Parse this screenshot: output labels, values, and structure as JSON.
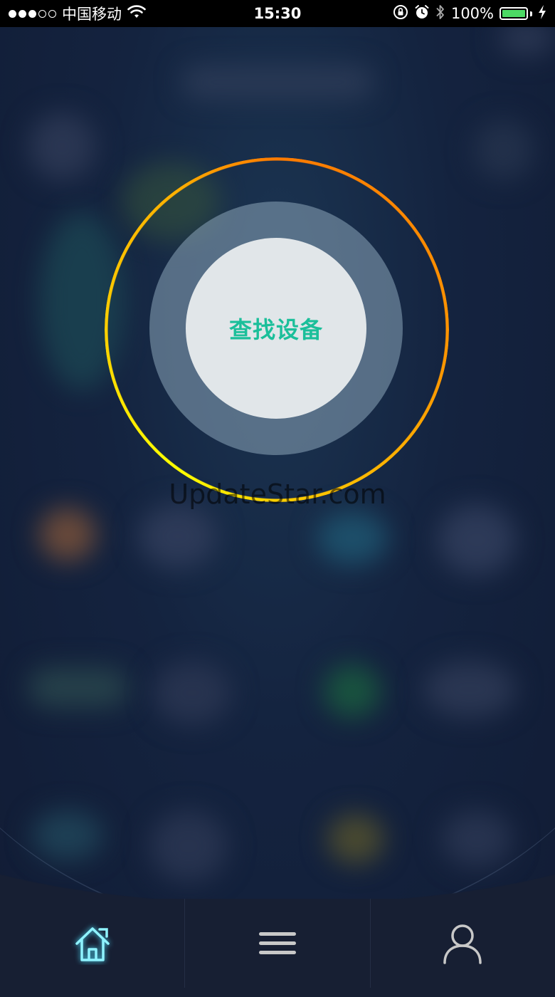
{
  "status_bar": {
    "carrier": "中国移动",
    "time": "15:30",
    "battery": "100%",
    "battery_level": 1.0,
    "icons": [
      "signal-dots",
      "wifi-icon",
      "orientation-lock-icon",
      "alarm-icon",
      "bluetooth-icon",
      "battery-icon",
      "charging-icon"
    ]
  },
  "search": {
    "label": "查找设备"
  },
  "watermark": "UpdateStar.com",
  "tabs": [
    {
      "icon": "home-icon",
      "active": true
    },
    {
      "icon": "menu-icon",
      "active": false
    },
    {
      "icon": "user-icon",
      "active": false
    }
  ],
  "colors": {
    "accent_text": "#1bbf9a",
    "ring_start": "#ff7a00",
    "ring_end": "#ffff00",
    "home_active": "#8ff3ff",
    "tab_inactive": "#c8c8c8",
    "background": "#121d35"
  }
}
